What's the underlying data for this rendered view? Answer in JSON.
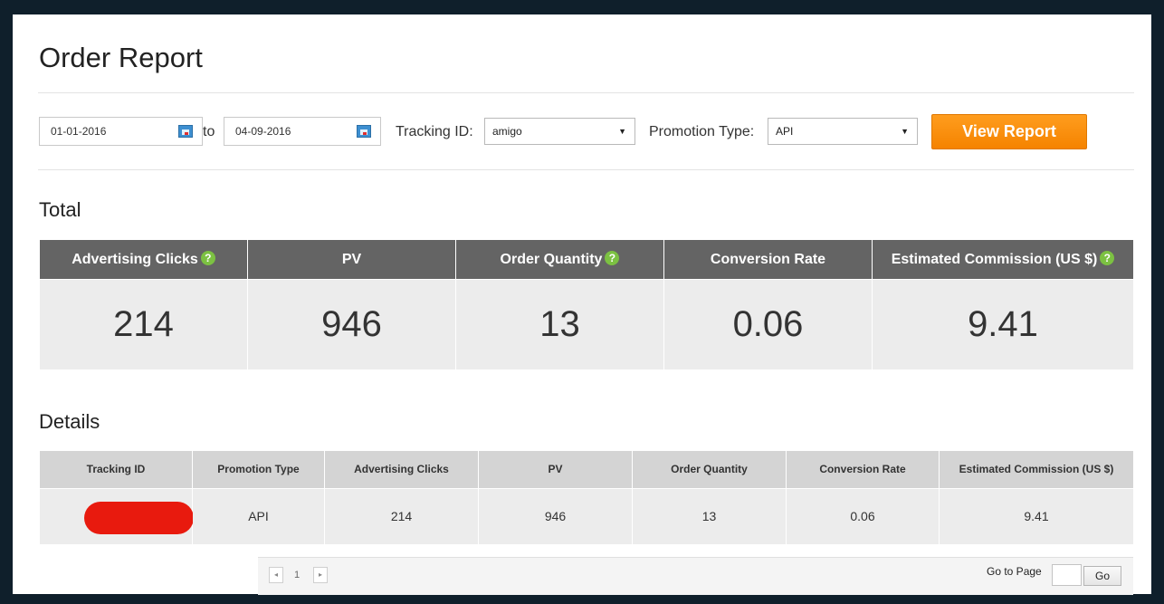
{
  "page": {
    "title": "Order Report"
  },
  "filters": {
    "start_date": "01-01-2016",
    "to_label": "to",
    "end_date": "04-09-2016",
    "tracking_id_label": "Tracking ID:",
    "tracking_id_value": "amigo",
    "promotion_type_label": "Promotion Type:",
    "promotion_type_value": "API",
    "view_report_label": "View Report"
  },
  "total": {
    "heading": "Total",
    "columns": [
      "Advertising Clicks",
      "PV",
      "Order Quantity",
      "Conversion Rate",
      "Estimated Commission (US $)"
    ],
    "values": [
      "214",
      "946",
      "13",
      "0.06",
      "9.41"
    ],
    "help_glyph": "?"
  },
  "details": {
    "heading": "Details",
    "columns": [
      "Tracking ID",
      "Promotion Type",
      "Advertising Clicks",
      "PV",
      "Order Quantity",
      "Conversion Rate",
      "Estimated Commission (US $)"
    ],
    "row": [
      "",
      "API",
      "214",
      "946",
      "13",
      "0.06",
      "9.41"
    ]
  },
  "pagination": {
    "prev_glyph": "◂",
    "current_page": "1",
    "next_glyph": "▸",
    "goto_label": "Go to Page",
    "goto_button": "Go"
  },
  "colors": {
    "accent": "#f58300",
    "header_dark": "#646464",
    "help_green": "#7cc142",
    "redaction": "#e81a0e"
  }
}
